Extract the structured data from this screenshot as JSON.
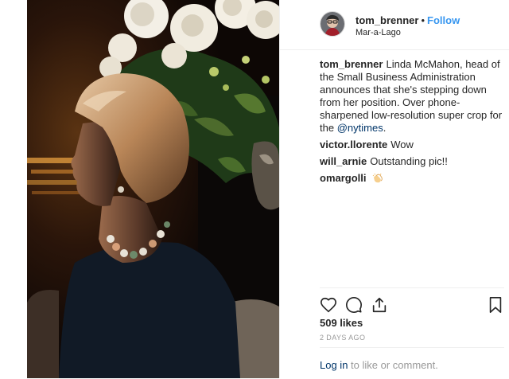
{
  "post": {
    "author": "tom_brenner",
    "follow_label": "Follow",
    "separator": "•",
    "location": "Mar-a-Lago",
    "caption": {
      "user": "tom_brenner",
      "prefix": "Linda McMahon, head of the Small Business Administration announces that she's stepping down from her position. Over phone-sharpened low-resolution super crop for the",
      "mention": "@nytimes",
      "suffix": "."
    },
    "comments": [
      {
        "user": "victor.llorente",
        "text": "Wow"
      },
      {
        "user": "will_arnie",
        "text": "Outstanding pic!!"
      },
      {
        "user": "omargolli",
        "text": ""
      }
    ],
    "likes": "509 likes",
    "time": "2 DAYS AGO",
    "footer": {
      "login": "Log in",
      "rest": "to like or comment."
    }
  },
  "icons": {
    "like": "heart-icon",
    "comment": "comment-bubble-icon",
    "share": "share-icon",
    "save": "bookmark-icon",
    "clap": "clapping-hands-emoji"
  },
  "colors": {
    "link": "#3897f0",
    "mention": "#003569",
    "muted": "#999999",
    "text": "#262626",
    "divider": "#efefef"
  }
}
